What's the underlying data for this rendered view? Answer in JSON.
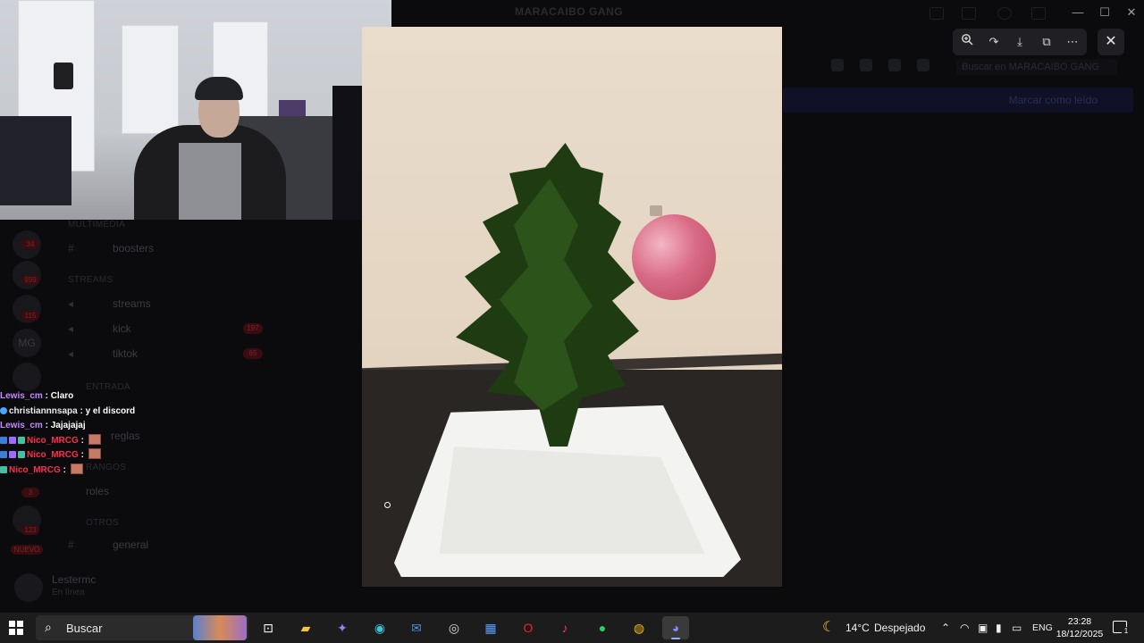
{
  "background": {
    "window_title": "MARACAIBO GANG",
    "banner_text": "Marcar como leído",
    "search_placeholder": "Buscar en MARACAIBO GANG",
    "categories": [
      "MULTIMEDIA",
      "STREAMS",
      "ENTRADA",
      "RANGOS",
      "OTROS"
    ],
    "channels": [
      {
        "name": "boosters"
      },
      {
        "name": "streams"
      },
      {
        "name": "kick",
        "count": "197"
      },
      {
        "name": "tiktok",
        "count": "65"
      },
      {
        "name": "reglas"
      },
      {
        "name": "roles"
      },
      {
        "name": "general"
      }
    ],
    "server_badges": [
      "34",
      "999",
      "115",
      "3",
      "123"
    ],
    "server_label": "MG",
    "new_badge": "NUEVO",
    "user": {
      "name": "Lestermc",
      "status": "En línea"
    }
  },
  "chat": [
    {
      "user": "Lewis_cm",
      "text": "Claro",
      "style": "u1",
      "badges": []
    },
    {
      "user": "christiannnsapa",
      "text": "y el discord",
      "style": "u2",
      "badges": [
        "#4aa8ff"
      ]
    },
    {
      "user": "Lewis_cm",
      "text": "Jajajajaj",
      "style": "u1",
      "badges": []
    },
    {
      "user": "Nico_MRCG",
      "text": "",
      "style": "u3",
      "badges": [
        "#3b7dd8",
        "#9d6bff",
        "#45c0a0"
      ],
      "emote": true
    },
    {
      "user": "Nico_MRCG",
      "text": "",
      "style": "u3",
      "badges": [
        "#3b7dd8",
        "#9d6bff",
        "#45c0a0"
      ],
      "emote": true
    },
    {
      "user": "Nico_MRCG",
      "text": "",
      "style": "u3",
      "badges": [
        "#45c0a0"
      ],
      "emote": true
    }
  ],
  "viewer": {
    "tools": [
      "zoom-in-icon",
      "rotate-icon",
      "download-icon",
      "open-external-icon",
      "more-icon"
    ],
    "close": "✕"
  },
  "taskbar": {
    "search_label": "Buscar",
    "apps": [
      "task-view",
      "file-explorer",
      "copilot",
      "edge",
      "mail",
      "obs",
      "store",
      "opera",
      "tiktok",
      "spotify",
      "chrome",
      "discord"
    ],
    "weather": {
      "temp": "14°C",
      "desc": "Despejado"
    },
    "language": "ENG",
    "time": "23:28",
    "date": "18/12/2025",
    "notifications": "1"
  }
}
